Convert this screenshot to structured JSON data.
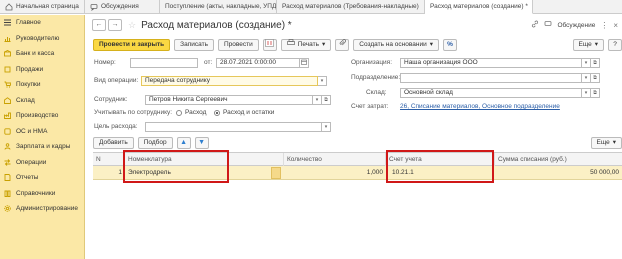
{
  "tabs": [
    {
      "label": "Начальная страница",
      "icon": "home-icon"
    },
    {
      "label": "Обсуждения",
      "icon": "discussions-icon"
    },
    {
      "label": "Поступление (акты, накладные, УПД)",
      "icon": "close-icon",
      "close": "×"
    },
    {
      "label": "Расход материалов (Требования-накладные)",
      "icon": "close-icon",
      "close": "×"
    },
    {
      "label": "Расход материалов (создание) *",
      "icon": "close-icon",
      "close": "×"
    }
  ],
  "sidebar": {
    "items": [
      {
        "label": "Главное",
        "icon": "menu-icon",
        "color": "#444444"
      },
      {
        "label": "Руководителю",
        "icon": "chart-icon",
        "color": "#3a7bd5"
      },
      {
        "label": "Банк и касса",
        "icon": "bank-icon",
        "color": "#3a7bd5"
      },
      {
        "label": "Продажи",
        "icon": "sales-icon",
        "color": "#3a7bd5"
      },
      {
        "label": "Покупки",
        "icon": "cart-icon",
        "color": "#3a7bd5"
      },
      {
        "label": "Склад",
        "icon": "warehouse-icon",
        "color": "#3a7bd5"
      },
      {
        "label": "Производство",
        "icon": "production-icon",
        "color": "#3a7bd5"
      },
      {
        "label": "ОС и НМА",
        "icon": "assets-icon",
        "color": "#3a7bd5"
      },
      {
        "label": "Зарплата и кадры",
        "icon": "people-icon",
        "color": "#3a7bd5"
      },
      {
        "label": "Операции",
        "icon": "operations-icon",
        "color": "#3a7bd5"
      },
      {
        "label": "Отчеты",
        "icon": "reports-icon",
        "color": "#3a7bd5"
      },
      {
        "label": "Справочники",
        "icon": "books-icon",
        "color": "#3a7bd5"
      },
      {
        "label": "Администрирование",
        "icon": "gear-icon",
        "color": "#3a7bd5"
      }
    ]
  },
  "header": {
    "back": "←",
    "forward": "→",
    "star": "☆",
    "title": "Расход материалов (создание) *",
    "discuss_label": "Обсуждение",
    "more_dots": "⋮",
    "close": "×"
  },
  "toolbar": {
    "post_close": "Провести и закрыть",
    "save": "Записать",
    "post": "Провести",
    "print": "Печать",
    "create_based": "Создать на основании",
    "more": "Еще",
    "help": "?"
  },
  "form": {
    "number_label": "Номер:",
    "number_value": "",
    "date_label": "от:",
    "date_value": "28.07.2021  0:00:00",
    "op_label": "Вид операции:",
    "op_value": "Передача сотруднику",
    "employee_label": "Сотрудник:",
    "employee_value": "Петров Никита Сергеевич",
    "consider_label": "Учитывать по сотруднику:",
    "radio_expense": "Расход",
    "radio_expense_rest": "Расход и остатки",
    "purpose_label": "Цель расхода:",
    "purpose_value": "",
    "org_label": "Организация:",
    "org_value": "Наша организация ООО",
    "division_label": "Подразделение:",
    "division_value": "",
    "warehouse_label": "Склад:",
    "warehouse_value": "Основной склад",
    "cost_acc_label": "Счет затрат:",
    "cost_acc_link": "26, Списание материалов, Основное подразделение"
  },
  "table_toolbar": {
    "add": "Добавить",
    "pick": "Подбор",
    "up": "▲",
    "down": "▼",
    "more": "Еще"
  },
  "table": {
    "columns": [
      "N",
      "Номенклатура",
      "Количество",
      "Счет учета",
      "Сумма списания (руб.)"
    ],
    "rows": [
      {
        "n": "1",
        "item": "Электродрель",
        "qty": "1,000",
        "account": "10.21.1",
        "sum": "50 000,00"
      }
    ]
  }
}
